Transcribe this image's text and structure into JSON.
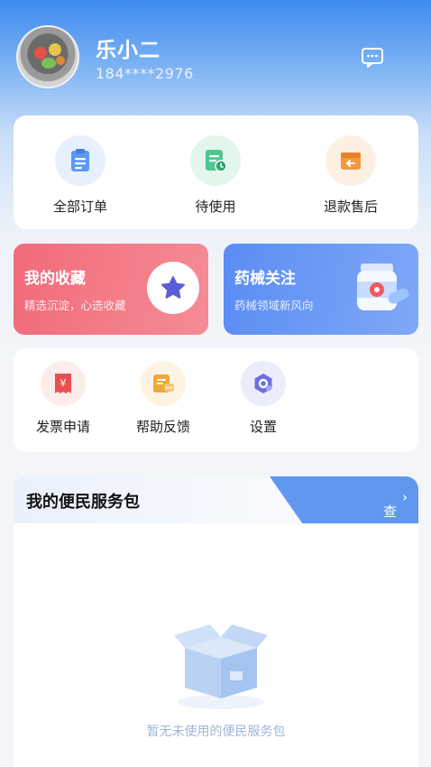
{
  "user": {
    "name": "乐小二",
    "phone": "184****2976"
  },
  "orders": [
    {
      "label": "全部订单",
      "icon": "order-list-icon",
      "bg": "#e7f0fd",
      "color": "#4d8ef0"
    },
    {
      "label": "待使用",
      "icon": "pending-use-icon",
      "bg": "#e3f6ec",
      "color": "#44c086"
    },
    {
      "label": "退款售后",
      "icon": "refund-icon",
      "bg": "#fdf0e3",
      "color": "#f0993b"
    }
  ],
  "promos": {
    "favorites": {
      "title": "我的收藏",
      "subtitle": "精选沉淀，心选收藏"
    },
    "medical": {
      "title": "药械关注",
      "subtitle": "药械领域新风向"
    }
  },
  "tools": [
    {
      "label": "发票申请",
      "icon": "invoice-icon"
    },
    {
      "label": "帮助反馈",
      "icon": "help-feedback-icon"
    },
    {
      "label": "设置",
      "icon": "settings-icon"
    }
  ],
  "service": {
    "title": "我的便民服务包",
    "view_all": "查看全部",
    "empty_text": "暂无未使用的便民服务包"
  }
}
